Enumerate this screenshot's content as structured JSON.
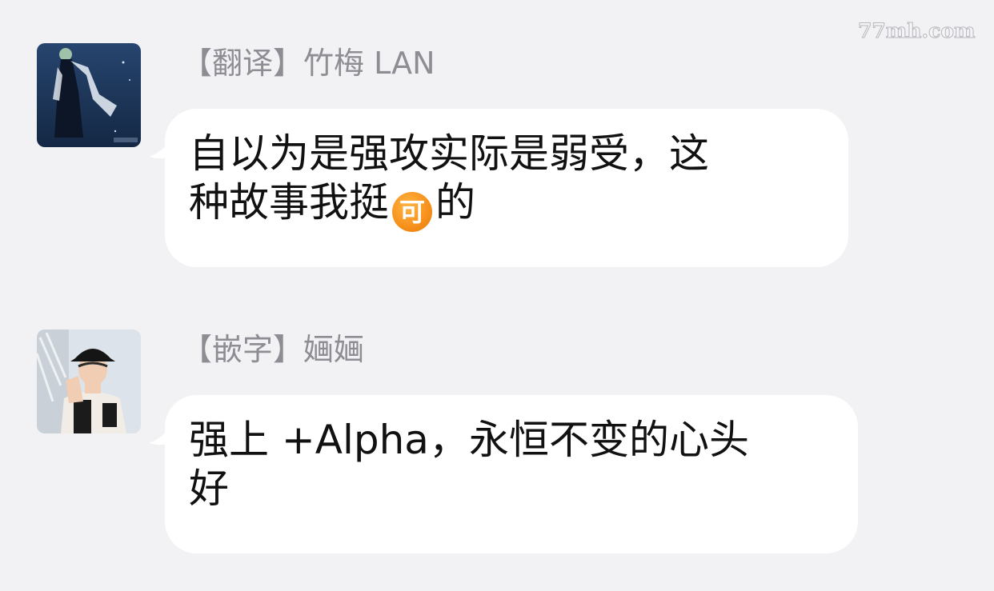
{
  "watermark": "77mh.com",
  "messages": [
    {
      "sender": "【翻译】竹梅 LAN",
      "avatar_icon": "user-avatar-anime-figure",
      "text_line1": "自以为是强攻实际是弱受，这",
      "text_line2_before": "种故事我挺",
      "emoji_text": "可",
      "emoji_icon": "ke-emoji-icon",
      "text_line2_after": "的"
    },
    {
      "sender": "【嵌字】婳婳",
      "avatar_icon": "user-avatar-photo-person",
      "text_line1": "强上 +Alpha，永恒不变的心头",
      "text_line2": "好"
    }
  ],
  "colors": {
    "background": "#f2f2f4",
    "bubble": "#ffffff",
    "sender_name": "#8d8d93",
    "message_text": "#111111",
    "emoji_orange": "#f7931e"
  }
}
